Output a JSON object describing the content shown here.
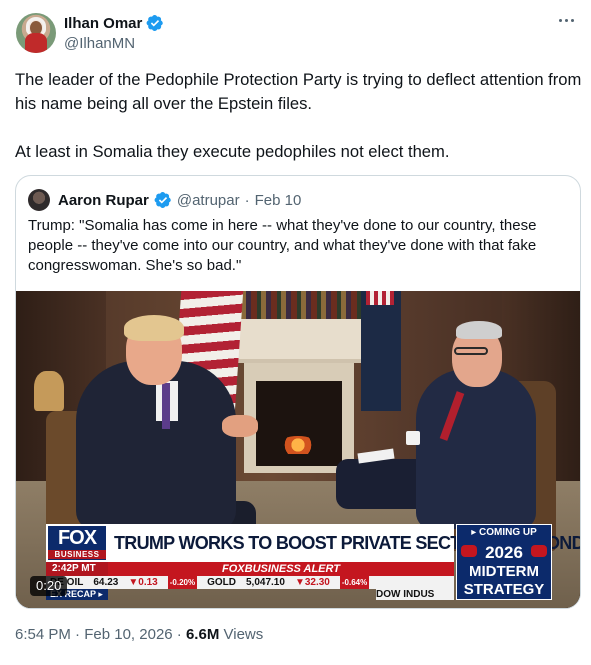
{
  "author": {
    "display_name": "Ilhan Omar",
    "handle": "@IlhanMN",
    "verified_icon": "verified-badge-icon"
  },
  "tweet": {
    "paragraph1": "The leader of the Pedophile Protection Party is trying to deflect attention from his name being all over the Epstein files.",
    "paragraph2": "At least in Somalia they execute pedophiles not elect them."
  },
  "quote": {
    "display_name": "Aaron Rupar",
    "handle": "@atrupar",
    "separator": "·",
    "date": "Feb 10",
    "text": "Trump: \"Somalia has come in here -- what they've done to our country, these people -- they've come into our country, and what they've done with that fake congresswoman. She's so bad.\""
  },
  "video": {
    "duration": "0:20",
    "chyron": {
      "logo_main": "FOX",
      "logo_sub": "BUSINESS",
      "time": "2:42P MT",
      "headline": "TRUMP WORKS TO BOOST PRIVATE SECTOR IN SECOND TERM",
      "alert": "FOXBUSINESS ALERT",
      "ticker_label": "DE OIL",
      "ticker_oil_val": "64.23",
      "ticker_oil_chg": "▼0.13",
      "ticker_oil_pct": "-0.20%",
      "ticker_gold_label": "GOLD",
      "ticker_gold_val": "5,047.10",
      "ticker_gold_chg": "▼32.30",
      "ticker_gold_pct": "-0.64%",
      "recap": "EX RECAP ▸",
      "ticker2": "DOW INDUS",
      "coming_up": "▸ COMING UP",
      "coming_year": "2026",
      "coming_line1": "MIDTERM",
      "coming_line2": "STRATEGY"
    }
  },
  "footer": {
    "time": "6:54 PM",
    "sep1": "·",
    "date": "Feb 10, 2026",
    "sep2": "·",
    "views_num": "6.6M",
    "views_label": "Views"
  },
  "colors": {
    "text": "#0f1419",
    "secondary": "#536471",
    "verified": "#1d9bf0",
    "border": "#cfd9de"
  }
}
